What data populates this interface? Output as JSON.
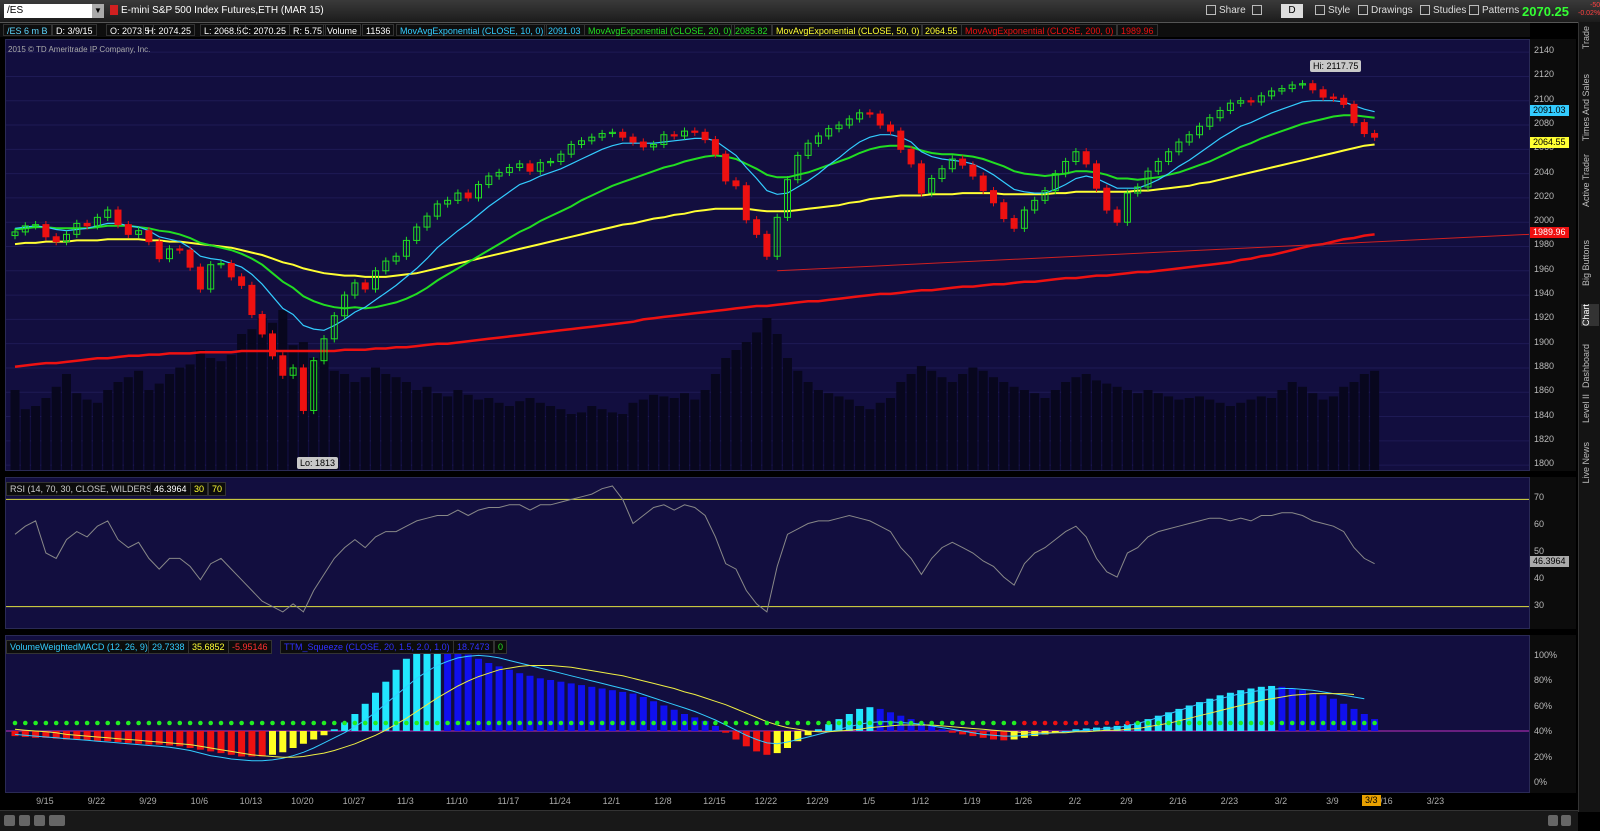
{
  "symbol": "/ES",
  "toolbar": {
    "description": "E-mini S&P 500 Index Futures,ETH (MAR 15)",
    "share": "Share",
    "d_label": "D",
    "style": "Style",
    "drawings": "Drawings",
    "studies": "Studies",
    "patterns": "Patterns",
    "last_price": "2070.25",
    "change_pts": "-50",
    "change_pct": "-0.02%"
  },
  "info": {
    "agg": "/ES 6 m B",
    "date": "D: 3/9/15",
    "open": "O: 2073.5",
    "high": "H: 2074.25",
    "low": "L: 2068.5",
    "close": "C: 2070.25",
    "range": "R: 5.75",
    "volume_label": "Volume",
    "volume": "11536",
    "ma10_label": "MovAvgExponential (CLOSE, 10, 0)",
    "ma10": "2091.03",
    "ma20_label": "MovAvgExponential (CLOSE, 20, 0)",
    "ma20": "2085.82",
    "ma50_label": "MovAvgExponential (CLOSE, 50, 0)",
    "ma50": "2064.55",
    "ma200_label": "MovAvgExponential (CLOSE, 200, 0)",
    "ma200": "1989.96"
  },
  "copyright": "2015 © TD Ameritrade IP Company, Inc.",
  "callouts": {
    "hi": "Hi: 2117.75",
    "lo": "Lo: 1813"
  },
  "rsi": {
    "label": "RSI (14, 70, 30, CLOSE, WILDERS)",
    "value": "46.3964",
    "lower": "30",
    "upper": "70"
  },
  "macd": {
    "label": "VolumeWeightedMACD (12, 26, 9)",
    "v1": "29.7338",
    "v2": "35.6852",
    "v3": "-5.95146",
    "squeeze_label": "TTM_Squeeze (CLOSE, 20, 1.5, 2.0, 1.0)",
    "squeeze_val": "18.7473",
    "squeeze_zero": "0"
  },
  "sidebar": [
    "Trade",
    "Times And Sales",
    "Active Trader",
    "Big Buttons",
    "Chart",
    "Dashboard",
    "Level II",
    "Live News"
  ],
  "date_marker": "3/3",
  "colors": {
    "ma10": "#33ccff",
    "ma20": "#22dd22",
    "ma50": "#ffff33",
    "ma200": "#ee1111",
    "up": "#22dd22",
    "down": "#ee1111",
    "pane": "#120e3f"
  },
  "chart_data": {
    "type": "candlestick",
    "x_ticks": [
      "9/15",
      "9/22",
      "9/29",
      "10/6",
      "10/13",
      "10/20",
      "10/27",
      "11/3",
      "11/10",
      "11/17",
      "11/24",
      "12/1",
      "12/8",
      "12/15",
      "12/22",
      "12/29",
      "1/5",
      "1/12",
      "1/19",
      "1/26",
      "2/2",
      "2/9",
      "2/16",
      "2/23",
      "3/2",
      "3/9",
      "3/16",
      "3/23"
    ],
    "price_ticks": [
      1800,
      1820,
      1840,
      1860,
      1880,
      1900,
      1920,
      1940,
      1960,
      1980,
      2000,
      2020,
      2040,
      2060,
      2080,
      2100,
      2120,
      2140
    ],
    "ylim": [
      1796,
      2150
    ],
    "closes": [
      1992,
      1997,
      1998,
      1988,
      1984,
      1990,
      1999,
      1997,
      2004,
      2010,
      1998,
      1990,
      1993,
      1984,
      1970,
      1978,
      1977,
      1963,
      1945,
      1965,
      1966,
      1955,
      1948,
      1924,
      1908,
      1890,
      1874,
      1880,
      1845,
      1886,
      1904,
      1923,
      1940,
      1950,
      1945,
      1960,
      1968,
      1972,
      1985,
      1996,
      2005,
      2015,
      2018,
      2024,
      2020,
      2031,
      2038,
      2041,
      2045,
      2048,
      2042,
      2049,
      2050,
      2056,
      2064,
      2067,
      2070,
      2073,
      2074,
      2070,
      2066,
      2062,
      2064,
      2072,
      2071,
      2075,
      2074,
      2068,
      2056,
      2034,
      2030,
      2002,
      1990,
      1972,
      2004,
      2035,
      2055,
      2065,
      2071,
      2077,
      2080,
      2085,
      2090,
      2089,
      2080,
      2075,
      2060,
      2048,
      2024,
      2036,
      2044,
      2052,
      2047,
      2038,
      2026,
      2016,
      2003,
      1995,
      2010,
      2018,
      2026,
      2040,
      2050,
      2058,
      2048,
      2028,
      2010,
      2000,
      2024,
      2029,
      2042,
      2050,
      2058,
      2066,
      2072,
      2079,
      2086,
      2092,
      2098,
      2100,
      2099,
      2104,
      2108,
      2110,
      2113,
      2114,
      2109,
      2103,
      2102,
      2097,
      2082,
      2073,
      2070
    ],
    "ma10": [
      1995,
      1996,
      1997,
      1996,
      1994,
      1993,
      1994,
      1995,
      1997,
      1999,
      1999,
      1997,
      1996,
      1993,
      1988,
      1986,
      1984,
      1979,
      1972,
      1970,
      1969,
      1966,
      1963,
      1957,
      1949,
      1939,
      1929,
      1924,
      1915,
      1912,
      1911,
      1915,
      1920,
      1926,
      1930,
      1936,
      1942,
      1948,
      1955,
      1962,
      1970,
      1979,
      1986,
      1993,
      1999,
      2006,
      2013,
      2019,
      2025,
      2031,
      2034,
      2038,
      2041,
      2044,
      2048,
      2052,
      2056,
      2060,
      2063,
      2065,
      2065,
      2065,
      2065,
      2066,
      2067,
      2068,
      2069,
      2069,
      2067,
      2061,
      2055,
      2045,
      2036,
      2026,
      2023,
      2024,
      2029,
      2034,
      2040,
      2047,
      2053,
      2060,
      2066,
      2070,
      2072,
      2072,
      2070,
      2066,
      2058,
      2054,
      2052,
      2051,
      2050,
      2048,
      2044,
      2039,
      2033,
      2027,
      2025,
      2024,
      2024,
      2027,
      2031,
      2036,
      2038,
      2036,
      2032,
      2028,
      2028,
      2028,
      2031,
      2035,
      2040,
      2046,
      2051,
      2057,
      2063,
      2069,
      2074,
      2079,
      2082,
      2086,
      2090,
      2093,
      2096,
      2099,
      2100,
      2100,
      2100,
      2099,
      2096,
      2093,
      2091
    ],
    "ma20": [
      1994,
      1995,
      1996,
      1996,
      1995,
      1995,
      1995,
      1995,
      1996,
      1997,
      1997,
      1997,
      1996,
      1995,
      1993,
      1992,
      1990,
      1987,
      1983,
      1981,
      1979,
      1977,
      1974,
      1970,
      1965,
      1958,
      1951,
      1946,
      1939,
      1935,
      1932,
      1930,
      1929,
      1930,
      1929,
      1930,
      1932,
      1934,
      1937,
      1941,
      1946,
      1952,
      1957,
      1962,
      1967,
      1972,
      1977,
      1982,
      1987,
      1992,
      1996,
      2001,
      2005,
      2009,
      2013,
      2018,
      2022,
      2026,
      2030,
      2033,
      2036,
      2039,
      2042,
      2045,
      2047,
      2050,
      2052,
      2054,
      2055,
      2054,
      2052,
      2048,
      2044,
      2039,
      2037,
      2037,
      2039,
      2041,
      2044,
      2047,
      2050,
      2053,
      2057,
      2060,
      2062,
      2063,
      2063,
      2062,
      2059,
      2057,
      2056,
      2056,
      2055,
      2054,
      2052,
      2049,
      2046,
      2042,
      2040,
      2039,
      2038,
      2039,
      2040,
      2042,
      2042,
      2041,
      2039,
      2036,
      2036,
      2035,
      2036,
      2037,
      2039,
      2041,
      2044,
      2047,
      2050,
      2054,
      2058,
      2062,
      2065,
      2069,
      2072,
      2075,
      2078,
      2081,
      2083,
      2085,
      2087,
      2088,
      2088,
      2087,
      2086
    ],
    "ma50": [
      1982,
      1983,
      1983,
      1984,
      1984,
      1984,
      1985,
      1985,
      1985,
      1986,
      1986,
      1986,
      1986,
      1985,
      1985,
      1984,
      1984,
      1983,
      1982,
      1981,
      1980,
      1979,
      1977,
      1975,
      1973,
      1970,
      1967,
      1965,
      1962,
      1960,
      1958,
      1957,
      1956,
      1956,
      1955,
      1955,
      1955,
      1956,
      1957,
      1958,
      1960,
      1962,
      1964,
      1966,
      1968,
      1970,
      1972,
      1974,
      1976,
      1978,
      1980,
      1982,
      1984,
      1986,
      1988,
      1990,
      1992,
      1994,
      1996,
      1998,
      1999,
      2001,
      2003,
      2004,
      2006,
      2007,
      2009,
      2010,
      2011,
      2011,
      2011,
      2011,
      2010,
      2009,
      2009,
      2009,
      2010,
      2011,
      2012,
      2013,
      2014,
      2016,
      2017,
      2019,
      2020,
      2021,
      2022,
      2022,
      2022,
      2023,
      2023,
      2023,
      2024,
      2024,
      2024,
      2024,
      2023,
      2023,
      2023,
      2023,
      2023,
      2024,
      2024,
      2025,
      2025,
      2025,
      2025,
      2025,
      2025,
      2026,
      2026,
      2027,
      2028,
      2029,
      2030,
      2032,
      2033,
      2035,
      2037,
      2039,
      2041,
      2043,
      2045,
      2047,
      2049,
      2051,
      2053,
      2055,
      2057,
      2059,
      2061,
      2063,
      2064
    ],
    "ma200": [
      1881,
      1882,
      1883,
      1884,
      1884,
      1885,
      1886,
      1887,
      1888,
      1888,
      1889,
      1890,
      1890,
      1891,
      1891,
      1892,
      1892,
      1892,
      1893,
      1893,
      1893,
      1893,
      1894,
      1894,
      1894,
      1894,
      1894,
      1894,
      1894,
      1894,
      1894,
      1894,
      1895,
      1895,
      1895,
      1896,
      1896,
      1897,
      1897,
      1898,
      1899,
      1900,
      1900,
      1901,
      1902,
      1903,
      1904,
      1905,
      1906,
      1907,
      1908,
      1909,
      1910,
      1911,
      1912,
      1913,
      1914,
      1915,
      1916,
      1917,
      1918,
      1920,
      1921,
      1922,
      1923,
      1924,
      1925,
      1926,
      1927,
      1928,
      1929,
      1930,
      1931,
      1931,
      1932,
      1933,
      1934,
      1935,
      1935,
      1936,
      1937,
      1938,
      1939,
      1940,
      1941,
      1941,
      1942,
      1943,
      1944,
      1944,
      1945,
      1946,
      1947,
      1947,
      1948,
      1949,
      1949,
      1950,
      1951,
      1951,
      1952,
      1953,
      1954,
      1954,
      1955,
      1956,
      1956,
      1957,
      1958,
      1959,
      1959,
      1960,
      1961,
      1962,
      1963,
      1964,
      1965,
      1966,
      1967,
      1969,
      1970,
      1972,
      1973,
      1975,
      1977,
      1979,
      1981,
      1982,
      1984,
      1986,
      1987,
      1989,
      1990
    ],
    "volume": [
      50,
      38,
      40,
      45,
      52,
      60,
      48,
      44,
      42,
      50,
      55,
      58,
      62,
      50,
      54,
      60,
      64,
      66,
      75,
      70,
      68,
      72,
      85,
      88,
      95,
      92,
      100,
      78,
      80,
      70,
      75,
      62,
      60,
      55,
      58,
      64,
      60,
      58,
      55,
      50,
      52,
      48,
      46,
      50,
      47,
      44,
      45,
      42,
      40,
      43,
      45,
      42,
      40,
      38,
      35,
      36,
      40,
      38,
      36,
      35,
      42,
      44,
      47,
      46,
      45,
      48,
      44,
      50,
      60,
      70,
      75,
      80,
      86,
      95,
      85,
      70,
      62,
      55,
      50,
      48,
      46,
      44,
      40,
      38,
      42,
      45,
      55,
      60,
      65,
      62,
      58,
      55,
      60,
      64,
      62,
      58,
      55,
      52,
      50,
      48,
      45,
      50,
      55,
      58,
      60,
      56,
      54,
      52,
      50,
      48,
      50,
      48,
      46,
      44,
      45,
      46,
      44,
      42,
      40,
      42,
      44,
      46,
      45,
      50,
      55,
      52,
      48,
      44,
      46,
      52,
      55,
      60,
      62
    ],
    "rsi": [
      57,
      60,
      62,
      50,
      48,
      55,
      58,
      56,
      60,
      62,
      55,
      52,
      54,
      48,
      44,
      48,
      48,
      45,
      40,
      46,
      48,
      44,
      40,
      36,
      32,
      30,
      28,
      31,
      28,
      36,
      42,
      48,
      52,
      55,
      52,
      56,
      58,
      58,
      60,
      62,
      63,
      64,
      64,
      66,
      64,
      66,
      67,
      67,
      68,
      68,
      66,
      68,
      68,
      69,
      70,
      71,
      72,
      74,
      75,
      70,
      61,
      64,
      67,
      68,
      66,
      68,
      67,
      64,
      56,
      46,
      44,
      36,
      31,
      28,
      45,
      57,
      59,
      61,
      62,
      62,
      63,
      64,
      63,
      62,
      60,
      58,
      52,
      48,
      42,
      48,
      52,
      54,
      52,
      50,
      47,
      45,
      41,
      38,
      46,
      50,
      52,
      55,
      58,
      60,
      56,
      48,
      43,
      41,
      50,
      52,
      56,
      58,
      59,
      60,
      61,
      62,
      63,
      63,
      62,
      63,
      62,
      64,
      64,
      65,
      65,
      64,
      62,
      61,
      60,
      58,
      52,
      48,
      46
    ],
    "macd_hist": [
      -6,
      -7,
      -8,
      -8,
      -9,
      -10,
      -10,
      -11,
      -12,
      -12,
      -13,
      -14,
      -15,
      -16,
      -16,
      -17,
      -18,
      -20,
      -22,
      -24,
      -26,
      -28,
      -30,
      -30,
      -30,
      -28,
      -25,
      -20,
      -15,
      -10,
      -5,
      2,
      10,
      20,
      32,
      45,
      58,
      72,
      85,
      94,
      100,
      102,
      100,
      96,
      90,
      85,
      80,
      76,
      72,
      68,
      65,
      62,
      60,
      58,
      56,
      54,
      52,
      50,
      48,
      46,
      44,
      40,
      35,
      30,
      25,
      20,
      16,
      12,
      6,
      -2,
      -10,
      -18,
      -24,
      -28,
      -26,
      -20,
      -12,
      -5,
      2,
      8,
      14,
      20,
      26,
      28,
      26,
      22,
      18,
      14,
      10,
      6,
      2,
      -2,
      -4,
      -6,
      -8,
      -10,
      -11,
      -10,
      -8,
      -6,
      -4,
      -2,
      0,
      2,
      3,
      4,
      5,
      6,
      8,
      10,
      14,
      18,
      22,
      26,
      30,
      34,
      38,
      42,
      45,
      48,
      50,
      52,
      53,
      52,
      50,
      48,
      45,
      42,
      38,
      32,
      26,
      20,
      14
    ],
    "macd_line": [
      -4,
      -5,
      -6,
      -7,
      -8,
      -9,
      -10,
      -11,
      -12,
      -13,
      -14,
      -15,
      -16,
      -17,
      -18,
      -19,
      -21,
      -23,
      -26,
      -29,
      -31,
      -33,
      -34,
      -35,
      -35,
      -34,
      -32,
      -29,
      -25,
      -20,
      -14,
      -8,
      -2,
      5,
      13,
      22,
      32,
      42,
      52,
      62,
      70,
      77,
      82,
      86,
      88,
      89,
      88,
      86,
      83,
      80,
      77,
      74,
      71,
      68,
      65,
      62,
      59,
      56,
      53,
      50,
      47,
      43,
      39,
      35,
      31,
      27,
      23,
      18,
      13,
      7,
      1,
      -5,
      -10,
      -14,
      -15,
      -13,
      -10,
      -7,
      -4,
      -1,
      2,
      5,
      8,
      10,
      11,
      11,
      10,
      9,
      8,
      6,
      4,
      2,
      0,
      -2,
      -4,
      -5,
      -6,
      -6,
      -5,
      -4,
      -3,
      -2,
      -1,
      0,
      1,
      2,
      3,
      4,
      6,
      9,
      12,
      16,
      20,
      24,
      28,
      32,
      35,
      38,
      41,
      44,
      46,
      48,
      49,
      50,
      50,
      49,
      48,
      46,
      44,
      42,
      40,
      38
    ],
    "macd_signal": [
      2,
      1,
      0,
      -1,
      -2,
      -4,
      -5,
      -6,
      -7,
      -8,
      -9,
      -10,
      -11,
      -12,
      -13,
      -14,
      -15,
      -16,
      -18,
      -20,
      -22,
      -24,
      -26,
      -28,
      -29,
      -30,
      -31,
      -31,
      -30,
      -28,
      -26,
      -23,
      -19,
      -15,
      -10,
      -5,
      1,
      8,
      15,
      23,
      31,
      39,
      46,
      53,
      59,
      64,
      68,
      72,
      74,
      76,
      77,
      77,
      77,
      76,
      75,
      73,
      71,
      69,
      67,
      65,
      62,
      59,
      56,
      53,
      50,
      46,
      43,
      39,
      35,
      31,
      26,
      21,
      16,
      11,
      7,
      4,
      2,
      0,
      -1,
      -1,
      0,
      1,
      2,
      4,
      5,
      6,
      7,
      7,
      7,
      7,
      6,
      5,
      4,
      3,
      2,
      1,
      0,
      -1,
      -2,
      -2,
      -2,
      -2,
      -2,
      -1,
      -1,
      0,
      1,
      1,
      2,
      3,
      5,
      7,
      9,
      12,
      15,
      18,
      21,
      24,
      27,
      30,
      33,
      36,
      38,
      40,
      42,
      43,
      44,
      44,
      44,
      44,
      43
    ],
    "squeeze_on": [
      0,
      0,
      0,
      0,
      0,
      0,
      0,
      0,
      0,
      0,
      0,
      0,
      0,
      0,
      0,
      0,
      0,
      0,
      0,
      0,
      0,
      0,
      0,
      0,
      0,
      0,
      0,
      0,
      0,
      0,
      0,
      0,
      0,
      0,
      0,
      0,
      0,
      0,
      0,
      0,
      0,
      0,
      0,
      0,
      0,
      0,
      0,
      0,
      0,
      0,
      0,
      0,
      0,
      0,
      0,
      0,
      0,
      0,
      0,
      0,
      0,
      0,
      0,
      0,
      0,
      0,
      0,
      0,
      0,
      0,
      0,
      0,
      0,
      0,
      0,
      0,
      0,
      0,
      0,
      0,
      0,
      0,
      0,
      0,
      0,
      0,
      0,
      0,
      0,
      0,
      0,
      0,
      0,
      0,
      0,
      0,
      0,
      0,
      1,
      1,
      1,
      1,
      1,
      1,
      1,
      1,
      1,
      1,
      1,
      0,
      0,
      0,
      0,
      0,
      0,
      0,
      0,
      0,
      0,
      0,
      0,
      0,
      0,
      0,
      0,
      0,
      0,
      0,
      0,
      0,
      0,
      0,
      0
    ],
    "rsi_levels": [
      30,
      70
    ],
    "rsi_ticks": [
      30,
      40,
      50,
      60,
      70
    ],
    "macd_pct_ticks": [
      "0%",
      "20%",
      "40%",
      "60%",
      "80%",
      "100%"
    ]
  }
}
